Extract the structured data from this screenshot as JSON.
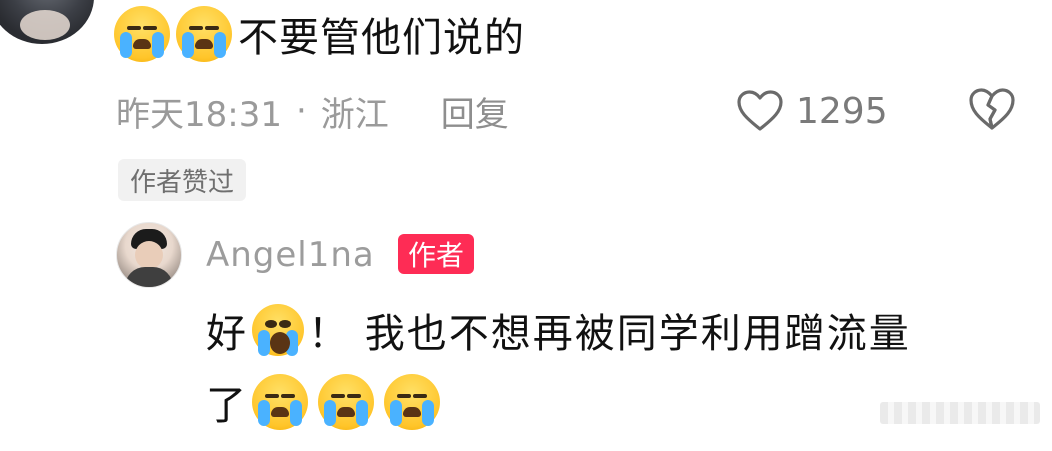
{
  "comment": {
    "text": "不要管他们说的",
    "time": "昨天18:31",
    "separator": "·",
    "location": "浙江",
    "reply_label": "回复",
    "like_count": "1295",
    "liked_by_author_badge": "作者赞过"
  },
  "reply": {
    "username": "Angel1na",
    "author_tag": "作者",
    "text_part1": "好",
    "text_part2": "！ 我也不想再被同学利用蹭流量",
    "text_line2": "了"
  },
  "colors": {
    "author_tag_bg": "#fe2c55",
    "meta_text": "#9a9a9a",
    "badge_bg": "#f1f1f1"
  },
  "icons": [
    "crying-face-emoji",
    "heart-outline-icon",
    "broken-heart-icon",
    "astonished-crying-emoji"
  ]
}
